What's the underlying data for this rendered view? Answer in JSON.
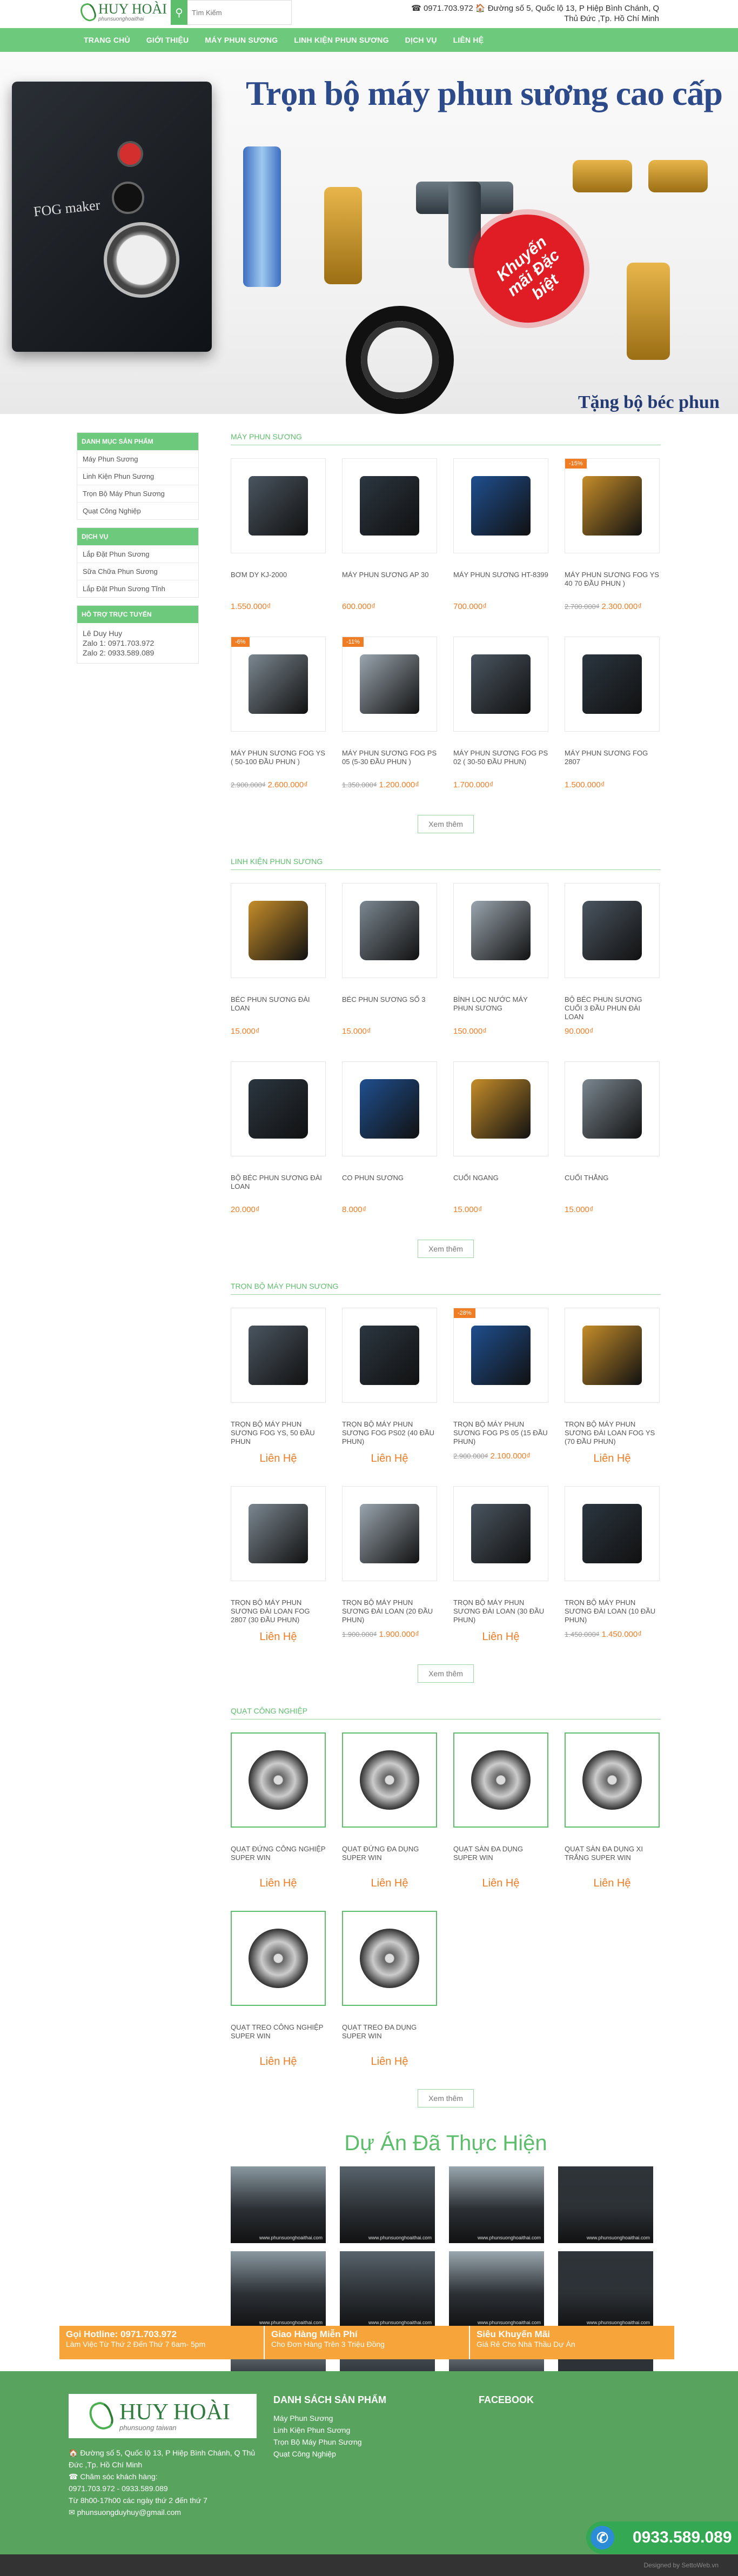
{
  "header": {
    "logo_main": "HUY HOÀI",
    "logo_sub": "phunsuonghoaithai",
    "search_placeholder": "Tìm Kiếm",
    "contact_line1": "☎ 0971.703.972  🏠 Đường số 5, Quốc lộ 13, P Hiệp Bình Chánh, Q",
    "contact_line2": "Thủ Đức ,Tp. Hồ Chí Minh"
  },
  "nav": [
    "TRANG CHỦ",
    "GIỚI THIỆU",
    "MÁY PHUN SƯƠNG",
    "LINH KIỆN PHUN SƯƠNG",
    "DỊCH VỤ",
    "LIÊN HỆ"
  ],
  "banner": {
    "title": "Trọn bộ máy phun sương cao cấp",
    "fog_label": "FOG maker",
    "promo": "Khuyến mãi Đặc biệt",
    "gift": "Tặng bộ béc phun"
  },
  "sidebar": {
    "cat_title": "DANH MỤC SẢN PHẨM",
    "cats": [
      "Máy Phun Sương",
      "Linh Kiện Phun Sương",
      "Trọn Bộ Máy Phun Sương",
      "Quạt Công Nghiệp"
    ],
    "svc_title": "DỊCH VỤ",
    "svcs": [
      "Lắp Đặt Phun Sương",
      "Sữa Chữa Phun Sương",
      "Lắp Đặt Phun Sương Tĩnh"
    ],
    "sup_title": "HỖ TRỢ TRỰC TUYẾN",
    "sup_lines": [
      "Lê Duy Huy",
      "Zalo 1: 0971.703.972",
      "Zalo 2: 0933.589.089"
    ]
  },
  "sections": [
    {
      "title": "MÁY PHUN SƯƠNG",
      "more": "Xem thêm",
      "items": [
        {
          "name": "BƠM DY KJ-2000",
          "price": "1.550.000₫",
          "old": "",
          "badge": ""
        },
        {
          "name": "MÁY PHUN SƯƠNG AP 30",
          "price": "600.000₫",
          "old": "",
          "badge": ""
        },
        {
          "name": "MÁY PHUN SƯƠNG HT-8399",
          "price": "700.000₫",
          "old": "",
          "badge": ""
        },
        {
          "name": "MÁY PHUN SƯƠNG FOG YS 40 70 ĐẦU PHUN )",
          "price": "2.300.000₫",
          "old": "2.700.000₫",
          "badge": "-15%"
        },
        {
          "name": "MÁY PHUN SƯƠNG FOG YS ( 50-100 ĐẦU PHUN )",
          "price": "2.600.000₫",
          "old": "2.900.000₫",
          "badge": "-6%"
        },
        {
          "name": "MÁY PHUN SƯƠNG FOG PS 05 (5-30 ĐẦU PHUN )",
          "price": "1.200.000₫",
          "old": "1.350.000₫",
          "badge": "-11%"
        },
        {
          "name": "MÁY PHUN SƯƠNG FOG PS 02 ( 30-50 ĐẦU PHUN)",
          "price": "1.700.000₫",
          "old": "",
          "badge": ""
        },
        {
          "name": "MÁY PHUN SƯƠNG FOG 2807",
          "price": "1.500.000₫",
          "old": "",
          "badge": ""
        }
      ]
    },
    {
      "title": "LINH KIỆN PHUN SƯƠNG",
      "more": "Xem thêm",
      "items": [
        {
          "name": "BÉC PHUN SƯƠNG ĐÀI LOAN",
          "price": "15.000₫",
          "old": "",
          "badge": ""
        },
        {
          "name": "BÉC PHUN SƯƠNG SỐ 3",
          "price": "15.000₫",
          "old": "",
          "badge": ""
        },
        {
          "name": "BÌNH LỌC NƯỚC MÁY PHUN SƯƠNG",
          "price": "150.000₫",
          "old": "",
          "badge": ""
        },
        {
          "name": "BỘ BÉC PHUN SƯƠNG CUỐI 3 ĐẦU PHUN ĐÀI LOAN",
          "price": "90.000₫",
          "old": "",
          "badge": ""
        },
        {
          "name": "BỘ BÉC PHUN SƯƠNG ĐÀI LOAN",
          "price": "20.000₫",
          "old": "",
          "badge": ""
        },
        {
          "name": "CO PHUN SƯƠNG",
          "price": "8.000₫",
          "old": "",
          "badge": ""
        },
        {
          "name": "CUỐI NGANG",
          "price": "15.000₫",
          "old": "",
          "badge": ""
        },
        {
          "name": "CUỐI THẲNG",
          "price": "15.000₫",
          "old": "",
          "badge": ""
        }
      ]
    },
    {
      "title": "TRỌN BỘ MÁY PHUN SƯƠNG",
      "more": "Xem thêm",
      "items": [
        {
          "name": "TRỌN BỘ MÁY PHUN SƯƠNG FOG YS, 50 ĐẦU PHUN",
          "price": "Liên Hệ",
          "old": "",
          "badge": ""
        },
        {
          "name": "TRỌN BỘ MÁY PHUN SƯƠNG FOG PS02 (40 ĐẦU PHUN)",
          "price": "Liên Hệ",
          "old": "",
          "badge": ""
        },
        {
          "name": "TRỌN BỘ MÁY PHUN SƯƠNG FOG PS 05 (15 ĐẦU PHUN)",
          "price": "2.100.000₫",
          "old": "2.900.000₫",
          "badge": "-28%"
        },
        {
          "name": "TRỌN BỘ MÁY PHUN SƯƠNG ĐÀI LOAN FOG YS (70 ĐẦU PHUN)",
          "price": "Liên Hệ",
          "old": "",
          "badge": ""
        },
        {
          "name": "TRỌN BỘ MÁY PHUN SƯƠNG ĐÀI LOAN FOG 2807 (30 ĐẦU PHUN)",
          "price": "Liên Hệ",
          "old": "",
          "badge": ""
        },
        {
          "name": "TRỌN BỘ MÁY PHUN SƯƠNG ĐÀI LOAN (20 ĐẦU PHUN)",
          "price": "1.900.000₫",
          "old": "1.900.000₫",
          "badge": ""
        },
        {
          "name": "TRỌN BỘ MÁY PHUN SƯƠNG ĐÀI LOAN (30 ĐẦU PHUN)",
          "price": "Liên Hệ",
          "old": "",
          "badge": ""
        },
        {
          "name": "TRỌN BỘ MÁY PHUN SƯƠNG ĐÀI LOAN (10 ĐẦU PHUN)",
          "price": "1.450.000₫",
          "old": "1.450.000₫",
          "badge": ""
        }
      ]
    },
    {
      "title": "QUẠT CÔNG NGHIỆP",
      "more": "Xem thêm",
      "items": [
        {
          "name": "QUẠT ĐỨNG CÔNG NGHIỆP SUPER WIN",
          "price": "Liên Hệ",
          "old": "",
          "badge": ""
        },
        {
          "name": "QUẠT ĐỨNG ĐA DỤNG SUPER WIN",
          "price": "Liên Hệ",
          "old": "",
          "badge": ""
        },
        {
          "name": "QUẠT SÀN ĐA DỤNG SUPER WIN",
          "price": "Liên Hệ",
          "old": "",
          "badge": ""
        },
        {
          "name": "QUẠT SÀN ĐA DỤNG XI TRẮNG SUPER WIN",
          "price": "Liên Hệ",
          "old": "",
          "badge": ""
        },
        {
          "name": "QUẠT TREO CÔNG NGHIỆP SUPER WIN",
          "price": "Liên Hệ",
          "old": "",
          "badge": ""
        },
        {
          "name": "QUẠT TREO ĐA DỤNG SUPER WIN",
          "price": "Liên Hệ",
          "old": "",
          "badge": ""
        }
      ]
    }
  ],
  "projects": {
    "title": "Dự Án Đã Thực Hiện",
    "watermark": "www.phunsuonghoaithai.com",
    "count_label": "12"
  },
  "strip": [
    {
      "title": "Gọi Hotline: 0971.703.972",
      "sub": "Làm Việc Từ Thứ 2 Đến Thứ 7 6am- 5pm"
    },
    {
      "title": "Giao Hàng Miễn Phí",
      "sub": "Cho Đơn Hàng Trên 3 Triệu Đồng"
    },
    {
      "title": "Siêu Khuyến Mãi",
      "sub": "Giá Rẻ Cho Nhà Thầu Dự Án"
    }
  ],
  "footer": {
    "logo_main": "HUY HOÀI",
    "logo_sub": "phunsuong taiwan",
    "addr": "🏠 Đường số 5, Quốc lộ 13, P Hiệp Bình Chánh, Q Thủ Đức ,Tp. Hồ Chí Minh",
    "care": "☎ Chăm sóc khách hàng:",
    "phones": "0971.703.972 - 0933.589.089",
    "hours": "Từ 8h00-17h00 các ngày thứ 2 đến thứ 7",
    "email": "✉ phunsuongduyhuy@gmail.com",
    "col1_title": "DANH SÁCH SẢN PHẨM",
    "col1_items": [
      "Máy Phun Sương",
      "Linh Kiện Phun Sương",
      "Trọn Bộ Máy Phun Sương",
      "Quạt Công Nghiệp"
    ],
    "col2_title": "FACEBOOK"
  },
  "hotline": "0933.589.089",
  "copyright": "Designed by SettoWeb.vn",
  "colors": {
    "green": "#6dc97b",
    "orange": "#f07c24",
    "footer": "#58a35e",
    "strip": "#f7a43a"
  }
}
